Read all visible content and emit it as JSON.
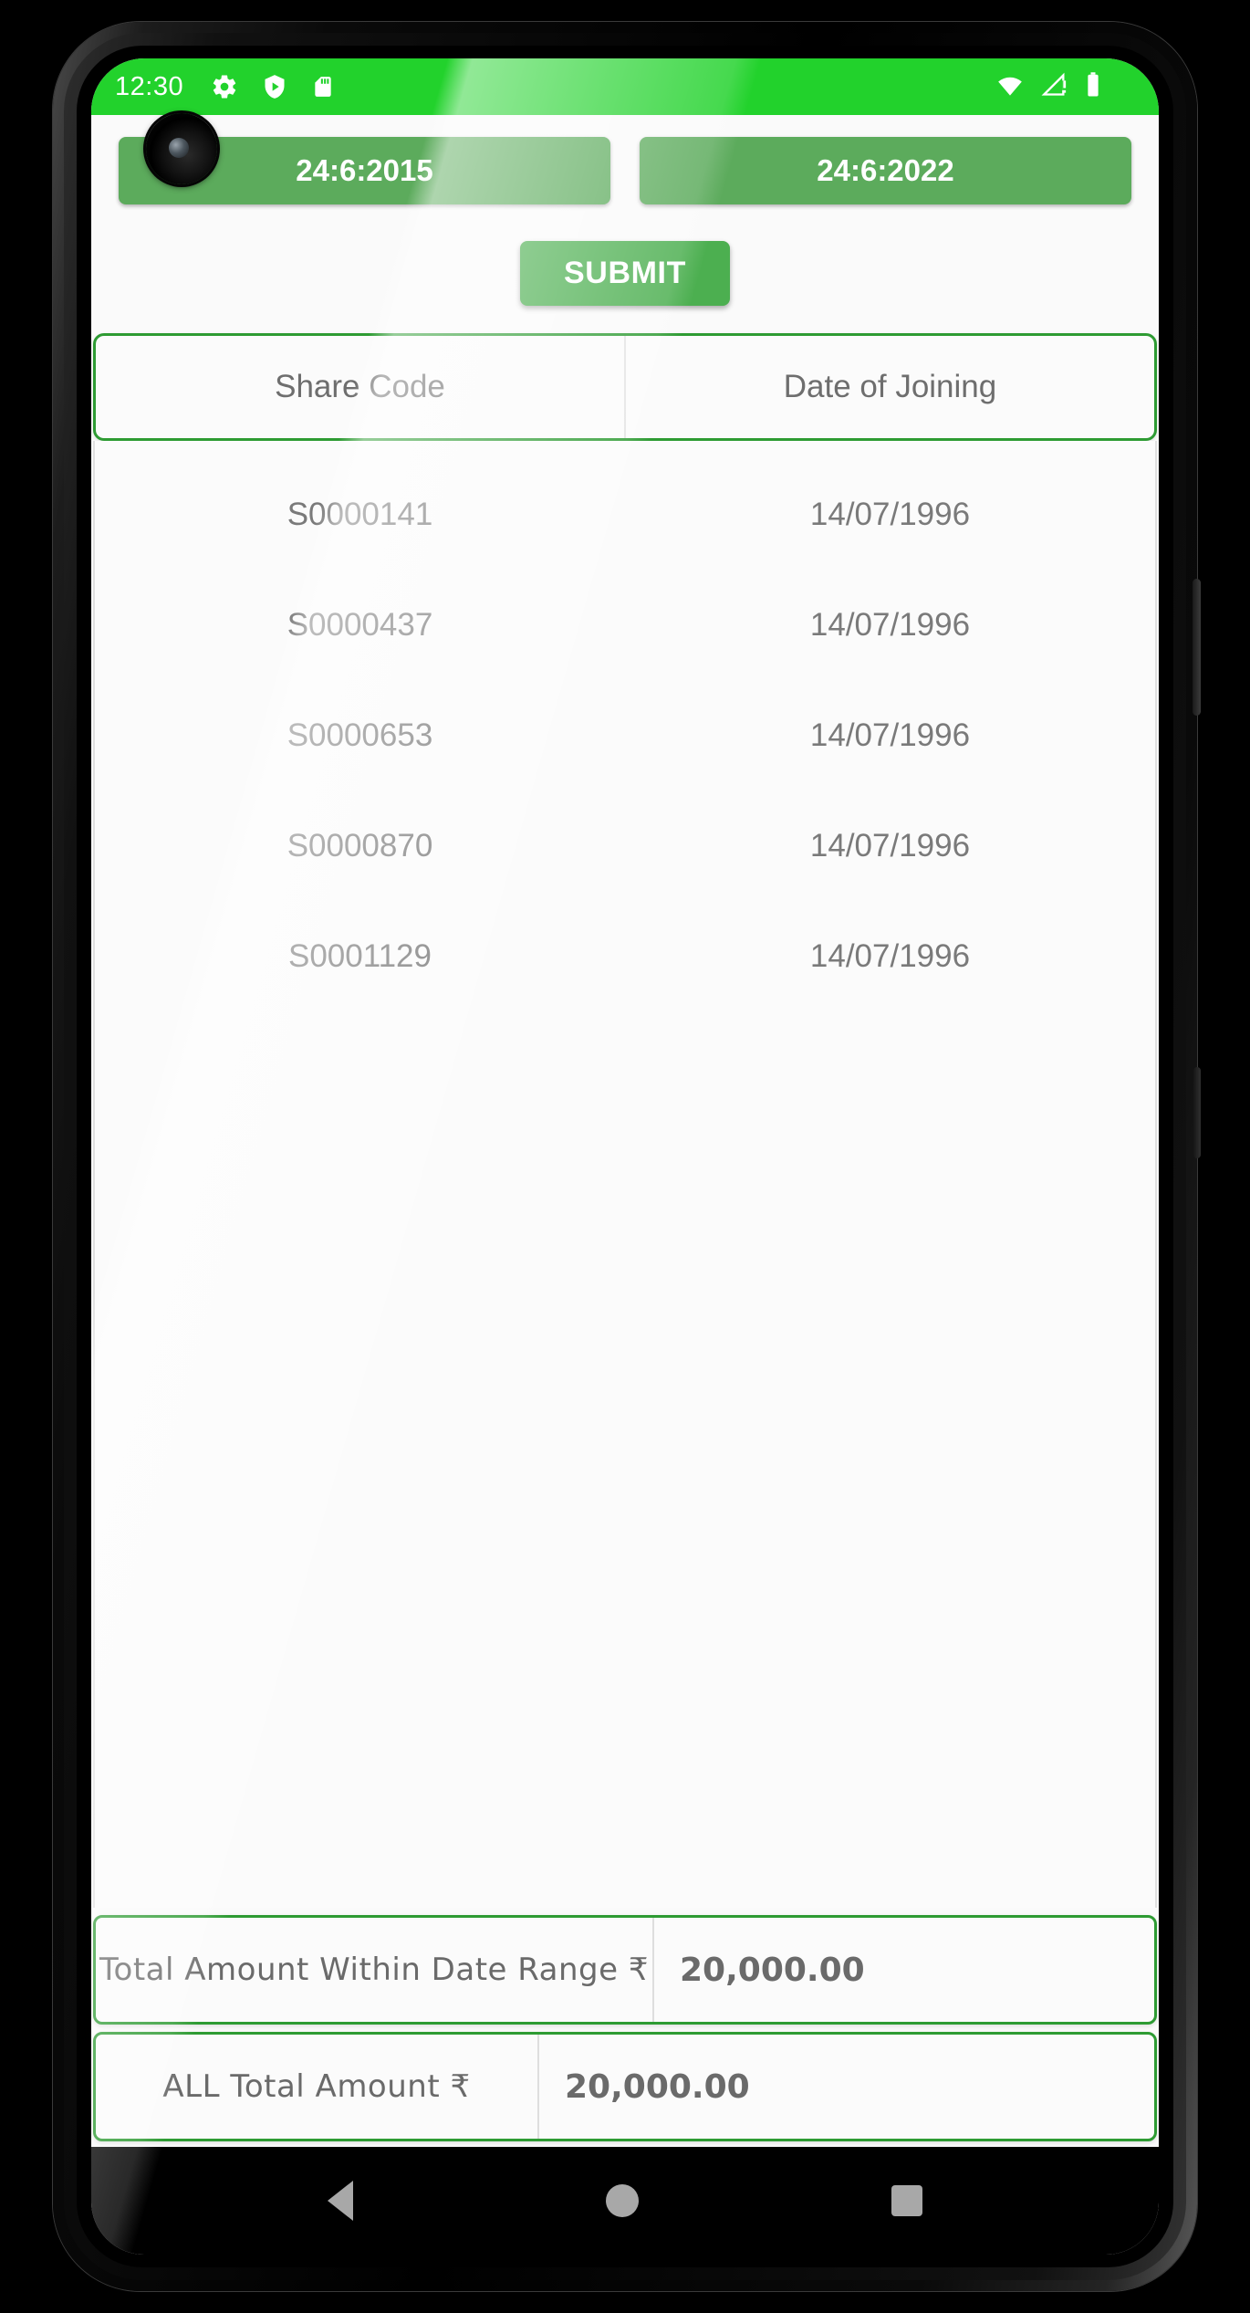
{
  "status_bar": {
    "time": "12:30",
    "left_icons": [
      "gear-icon",
      "shield-play-icon",
      "sd-card-icon"
    ],
    "right_icons": [
      "wifi-icon",
      "signal-warning-icon",
      "battery-icon"
    ],
    "background_color": "#22d22c"
  },
  "date_range": {
    "from_label": "24:6:2015",
    "to_label": "24:6:2022",
    "button_color": "#5cab5c"
  },
  "submit": {
    "label": "SUBMIT",
    "color": "#4caf50"
  },
  "table": {
    "columns": [
      "Share Code",
      "Date of Joining"
    ],
    "rows": [
      {
        "share_code": "S0000141",
        "date_of_joining": "14/07/1996"
      },
      {
        "share_code": "S0000437",
        "date_of_joining": "14/07/1996"
      },
      {
        "share_code": "S0000653",
        "date_of_joining": "14/07/1996"
      },
      {
        "share_code": "S0000870",
        "date_of_joining": "14/07/1996"
      },
      {
        "share_code": "S0001129",
        "date_of_joining": "14/07/1996"
      }
    ],
    "border_color": "#2e9b33"
  },
  "totals": {
    "range_total_label": "Total Amount Within Date Range ₹",
    "range_total_value": "20,000.00",
    "all_total_label": "ALL Total  Amount ₹",
    "all_total_value": "20,000.00"
  },
  "nav_bar": {
    "back": "back-triangle-icon",
    "home": "home-circle-icon",
    "recents": "recents-square-icon"
  }
}
